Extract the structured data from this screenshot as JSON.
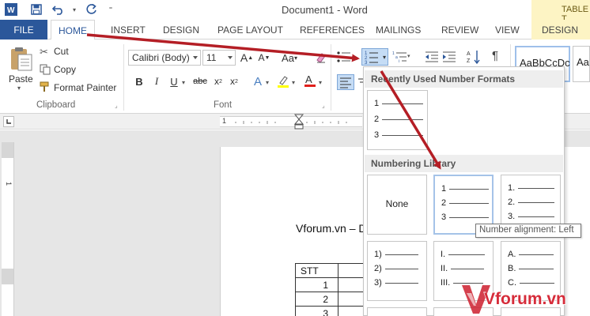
{
  "window": {
    "title": "Document1 - Word",
    "contextual_tab_group": "TABLE T"
  },
  "tabs": {
    "file": "FILE",
    "home": "HOME",
    "insert": "INSERT",
    "design": "DESIGN",
    "page_layout": "PAGE LAYOUT",
    "references": "REFERENCES",
    "mailings": "MAILINGS",
    "review": "REVIEW",
    "view": "VIEW",
    "table_design": "DESIGN"
  },
  "clipboard": {
    "paste": "Paste",
    "cut": "Cut",
    "copy": "Copy",
    "format_painter": "Format Painter",
    "label": "Clipboard"
  },
  "font": {
    "name": "Calibri (Body)",
    "size": "11",
    "label": "Font"
  },
  "styles": {
    "style1": "AaBbCcDc",
    "style2": "Aa"
  },
  "numbering_menu": {
    "recent_header": "Recently Used Number Formats",
    "library_header": "Numbering Library",
    "recent": [
      "1",
      "2",
      "3"
    ],
    "none_label": "None",
    "tiles": [
      {
        "labels": [
          "1",
          "2",
          "3"
        ],
        "selected": true
      },
      {
        "labels": [
          "1.",
          "2.",
          "3."
        ]
      },
      {
        "labels": [
          "1)",
          "2)",
          "3)"
        ]
      },
      {
        "labels": [
          "I.",
          "II.",
          "III."
        ]
      },
      {
        "labels": [
          "A.",
          "B.",
          "C."
        ]
      }
    ]
  },
  "tooltip": "Number alignment: Left",
  "document": {
    "line": "Vforum.vn – D",
    "table_header": "STT",
    "rows": [
      "1",
      "2",
      "3"
    ]
  },
  "watermark": {
    "text": "Vforum.vn",
    "color": "#cc1f2e"
  },
  "ruler": {
    "h_mark": "1",
    "v_mark": "1"
  },
  "colors": {
    "accent": "#2b579a",
    "table_tools": "#fdf4c4",
    "arrow": "#b41e25"
  }
}
